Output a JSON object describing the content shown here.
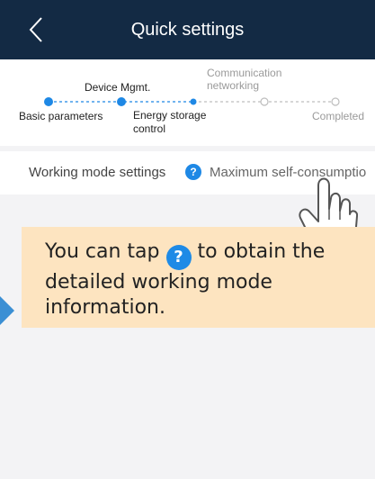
{
  "header": {
    "title": "Quick settings",
    "back_icon": "chevron-left-icon"
  },
  "steps": {
    "device_mgmt": "Device Mgmt.",
    "communication_line1": "Communication",
    "communication_line2": "networking",
    "basic_parameters": "Basic parameters",
    "energy_storage_line1": "Energy storage",
    "energy_storage_line2": "control",
    "completed": "Completed"
  },
  "working_mode": {
    "label": "Working mode settings",
    "help_icon": "question-icon",
    "value": "Maximum self-consumptio"
  },
  "callout": {
    "text_before": "You can tap",
    "text_after": "to obtain the detailed working mode information.",
    "icon_glyph": "?"
  },
  "colors": {
    "header_bg": "#132a44",
    "accent": "#1e88e5",
    "callout_bg": "#fde4c0",
    "pointer_arrow": "#3b8fd4"
  }
}
